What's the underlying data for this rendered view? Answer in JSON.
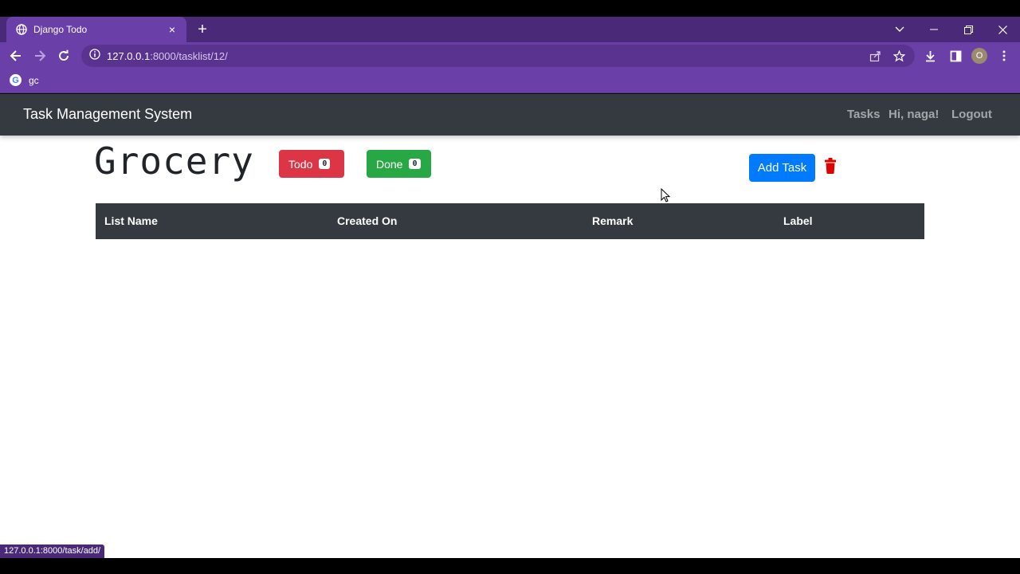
{
  "browser": {
    "tab_title": "Django Todo",
    "tab_close": "×",
    "new_tab": "+",
    "url_host": "127.0.0.1",
    "url_rest": ":8000/tasklist/12/",
    "profile_initial": "O",
    "bookmark_label": "gc",
    "bookmark_icon": "G",
    "status_url": "127.0.0.1:8000/task/add/"
  },
  "navbar": {
    "brand": "Task Management System",
    "links": [
      "Tasks",
      "Hi, naga!",
      "Logout"
    ]
  },
  "list": {
    "title": "Grocery",
    "todo_label": "Todo",
    "todo_count": "0",
    "done_label": "Done",
    "done_count": "0",
    "add_task_label": "Add Task"
  },
  "table": {
    "columns": [
      "List Name",
      "Created On",
      "Remark",
      "Label"
    ],
    "rows": []
  },
  "colors": {
    "chrome_purple": "#6b3fa8",
    "navbar_dark": "#343a40",
    "todo_red": "#dc3545",
    "done_green": "#28a745",
    "add_blue": "#007bff",
    "trash_red": "#e00000"
  }
}
